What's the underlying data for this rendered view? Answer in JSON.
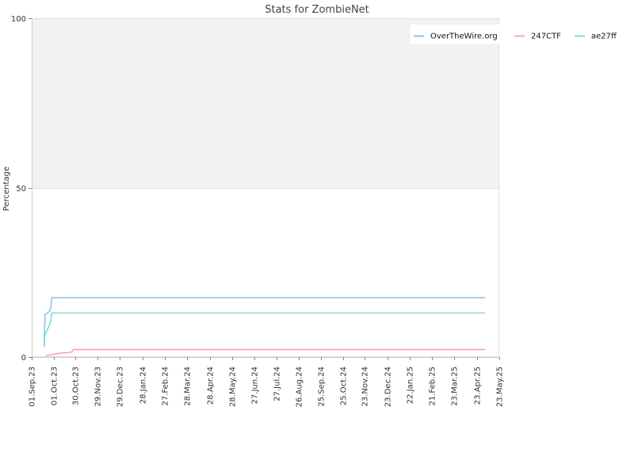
{
  "chart_data": {
    "type": "line",
    "title": "Stats for ZombieNet",
    "xlabel": "",
    "ylabel": "Percentage",
    "ylim": [
      0,
      100
    ],
    "xlim": [
      "2023-09-01",
      "2025-05-23"
    ],
    "y_ticks": [
      0,
      50,
      100
    ],
    "x_ticks": [
      {
        "date": "2023-09-01",
        "label": "01.Sep.23"
      },
      {
        "date": "2023-10-01",
        "label": "01.Oct.23"
      },
      {
        "date": "2023-10-30",
        "label": "30.Oct.23"
      },
      {
        "date": "2023-11-29",
        "label": "29.Nov.23"
      },
      {
        "date": "2023-12-29",
        "label": "29.Dec.23"
      },
      {
        "date": "2024-01-28",
        "label": "28.Jan.24"
      },
      {
        "date": "2024-02-27",
        "label": "27.Feb.24"
      },
      {
        "date": "2024-03-28",
        "label": "28.Mar.24"
      },
      {
        "date": "2024-04-28",
        "label": "28.Apr.24"
      },
      {
        "date": "2024-05-28",
        "label": "28.May.24"
      },
      {
        "date": "2024-06-27",
        "label": "27.Jun.24"
      },
      {
        "date": "2024-07-27",
        "label": "27.Jul.24"
      },
      {
        "date": "2024-08-26",
        "label": "26.Aug.24"
      },
      {
        "date": "2024-09-25",
        "label": "25.Sep.24"
      },
      {
        "date": "2024-10-25",
        "label": "25.Oct.24"
      },
      {
        "date": "2024-11-23",
        "label": "23.Nov.24"
      },
      {
        "date": "2024-12-23",
        "label": "23.Dec.24"
      },
      {
        "date": "2025-01-22",
        "label": "22.Jan.25"
      },
      {
        "date": "2025-02-21",
        "label": "21.Feb.25"
      },
      {
        "date": "2025-03-23",
        "label": "23.Mar.25"
      },
      {
        "date": "2025-04-23",
        "label": "23.Apr.25"
      },
      {
        "date": "2025-05-23",
        "label": "23.May.25"
      }
    ],
    "legend_position": "top-right",
    "grid": true,
    "series": [
      {
        "name": "OverTheWire.org",
        "color": "#90c0ea",
        "points": [
          [
            "2023-09-18",
            3
          ],
          [
            "2023-09-18",
            6
          ],
          [
            "2023-09-19",
            12.5
          ],
          [
            "2023-09-25",
            13.5
          ],
          [
            "2023-09-27",
            15
          ],
          [
            "2023-09-28",
            17.5
          ],
          [
            "2023-10-05",
            17.5
          ],
          [
            "2025-05-04",
            17.5
          ]
        ]
      },
      {
        "name": "247CTF",
        "color": "#f5a0c0",
        "points": [
          [
            "2023-09-20",
            0.2
          ],
          [
            "2023-09-22",
            0.5
          ],
          [
            "2023-09-28",
            0.7
          ],
          [
            "2023-10-05",
            1.0
          ],
          [
            "2023-10-12",
            1.2
          ],
          [
            "2023-10-20",
            1.3
          ],
          [
            "2023-10-25",
            1.5
          ],
          [
            "2023-10-27",
            2.2
          ],
          [
            "2025-05-04",
            2.2
          ]
        ]
      },
      {
        "name": "ae27ff",
        "color": "#80e0c8",
        "points": [
          [
            "2023-09-18",
            5
          ],
          [
            "2023-09-19",
            6.5
          ],
          [
            "2023-09-22",
            8
          ],
          [
            "2023-09-25",
            9.5
          ],
          [
            "2023-09-27",
            11
          ],
          [
            "2023-09-28",
            13
          ],
          [
            "2025-05-04",
            13
          ]
        ]
      }
    ]
  }
}
